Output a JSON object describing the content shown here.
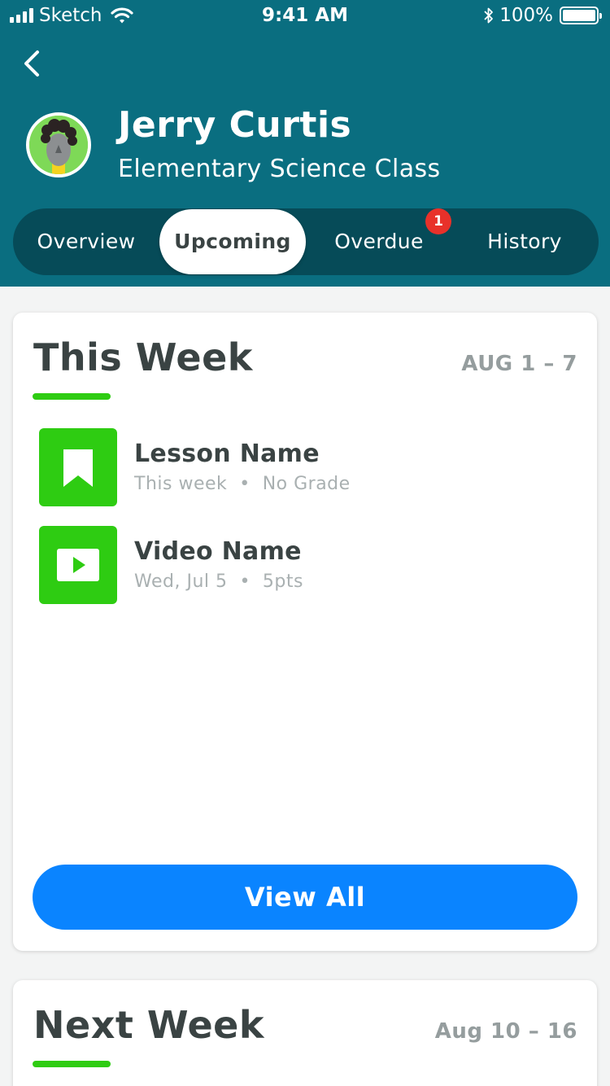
{
  "status_bar": {
    "carrier": "Sketch",
    "time": "9:41 AM",
    "battery": "100%"
  },
  "header": {
    "back_icon": "chevron-left-icon",
    "student_name": "Jerry Curtis",
    "class_name": "Elementary Science Class"
  },
  "tabs": [
    {
      "label": "Overview",
      "active": false
    },
    {
      "label": "Upcoming",
      "active": true
    },
    {
      "label": "Overdue",
      "active": false,
      "badge": "1"
    },
    {
      "label": "History",
      "active": false
    }
  ],
  "this_week": {
    "title": "This Week",
    "range": "AUG 1 – 7",
    "items": [
      {
        "title": "Lesson Name",
        "meta": "This week  •  No Grade",
        "icon": "bookmark-icon"
      },
      {
        "title": "Video Name",
        "meta": "Wed, Jul 5  •  5pts",
        "icon": "video-play-icon"
      }
    ],
    "button": "View All"
  },
  "next_week": {
    "title": "Next Week",
    "range": "Aug 10 – 16"
  },
  "colors": {
    "header": "#0a6e80",
    "tabs_bg": "#064b58",
    "accent_green": "#2ecc12",
    "button_blue": "#0a84ff",
    "badge_red": "#e8312a"
  }
}
